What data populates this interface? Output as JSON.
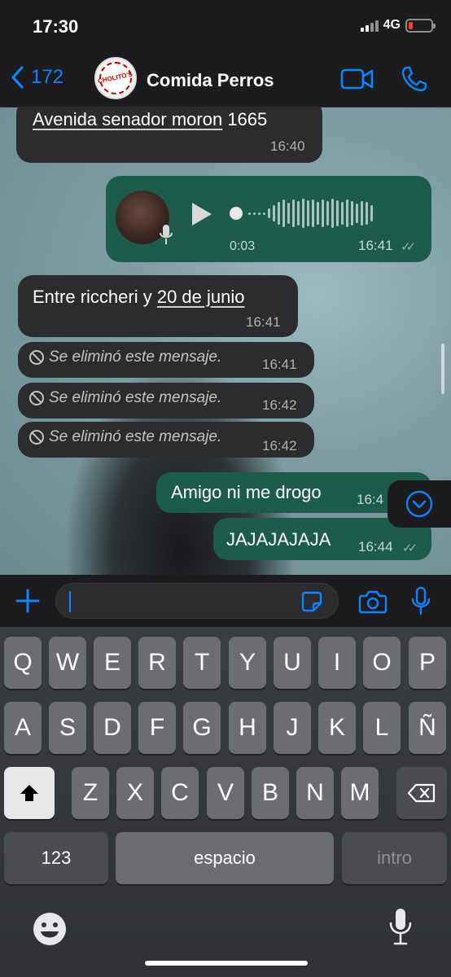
{
  "status_bar": {
    "time": "17:30",
    "network": "4G",
    "battery_color": "#ff3b30"
  },
  "header": {
    "back_count": "172",
    "contact_name": "Comida Perros",
    "avatar_text": "CHOLITO'S",
    "accent": "#0a84ff"
  },
  "messages": [
    {
      "type": "text",
      "direction": "in",
      "text_a": "Avenida senador moron",
      "text_b": " 1665",
      "time": "16:40"
    },
    {
      "type": "voice",
      "direction": "out",
      "duration": "0:03",
      "time": "16:41"
    },
    {
      "type": "text",
      "direction": "in",
      "text_a": "Entre riccheri y ",
      "text_b": "20 de junio",
      "time": "16:41"
    },
    {
      "type": "deleted",
      "direction": "in",
      "text": "Se eliminó este mensaje.",
      "time": "16:41"
    },
    {
      "type": "deleted",
      "direction": "in",
      "text": "Se eliminó este mensaje.",
      "time": "16:42"
    },
    {
      "type": "deleted",
      "direction": "in",
      "text": "Se eliminó este mensaje.",
      "time": "16:42"
    },
    {
      "type": "text",
      "direction": "out",
      "text": "Amigo ni me drogo",
      "time": "16:4"
    },
    {
      "type": "text",
      "direction": "out",
      "text": "JAJAJAJAJA",
      "time": "16:44"
    }
  ],
  "keyboard": {
    "row1": [
      "Q",
      "W",
      "E",
      "R",
      "T",
      "Y",
      "U",
      "I",
      "O",
      "P"
    ],
    "row2": [
      "A",
      "S",
      "D",
      "F",
      "G",
      "H",
      "J",
      "K",
      "L",
      "Ñ"
    ],
    "row3": [
      "Z",
      "X",
      "C",
      "V",
      "B",
      "N",
      "M"
    ],
    "numbers_label": "123",
    "space_label": "espacio",
    "return_label": "intro"
  },
  "icons": [
    "chevron-left-icon",
    "video-icon",
    "phone-icon",
    "play-icon",
    "microphone-icon",
    "plus-icon",
    "sticker-icon",
    "camera-icon",
    "shift-icon",
    "backspace-icon",
    "emoji-icon",
    "chevron-down-icon",
    "prohibited-icon"
  ]
}
